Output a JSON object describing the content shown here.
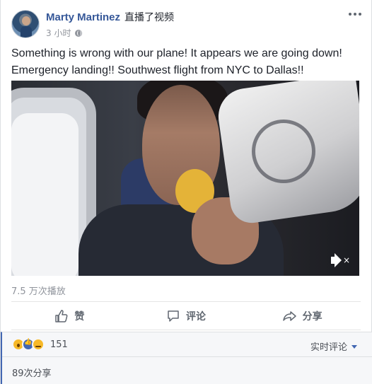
{
  "post": {
    "author": "Marty Martinez",
    "action": "直播了视频",
    "time": "3 小时",
    "text_line1": "Something is wrong with our plane! It appears we are going down!",
    "text_line2": "Emergency landing!! Southwest flight from NYC to Dallas!!",
    "views": "7.5 万次播放"
  },
  "video": {
    "mute_symbol": "×"
  },
  "actions": {
    "like": "赞",
    "comment": "评论",
    "share": "分享"
  },
  "footer": {
    "reaction_count": "151",
    "sort_label": "实时评论",
    "shares": "89次分享"
  },
  "icons": {
    "privacy": "globe-icon",
    "more": "more-options-icon",
    "like": "thumbs-up-icon",
    "comment": "comment-bubble-icon",
    "share": "share-arrow-icon",
    "mute": "speaker-muted-icon"
  },
  "colors": {
    "link": "#365899",
    "muted": "#90949c",
    "accent": "#4267b2",
    "footer_bg": "#f6f7f9"
  }
}
